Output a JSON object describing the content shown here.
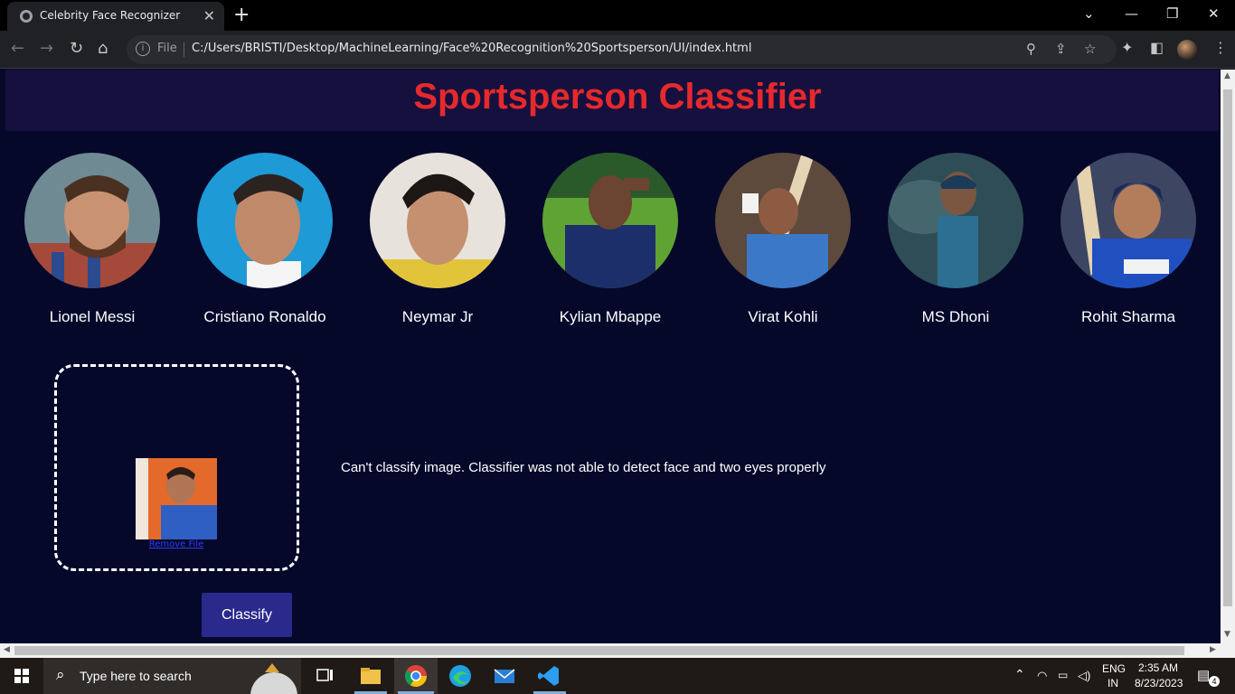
{
  "browser": {
    "tab_title": "Celebrity Face Recognizer",
    "close_tab": "✕",
    "new_tab": "+",
    "file_label": "File",
    "url": "C:/Users/BRISTI/Desktop/MachineLearning/Face%20Recognition%20Sportsperson/UI/index.html"
  },
  "page": {
    "title": "Sportsperson Classifier",
    "players": [
      {
        "name": "Lionel Messi"
      },
      {
        "name": "Cristiano Ronaldo"
      },
      {
        "name": "Neymar Jr"
      },
      {
        "name": "Kylian Mbappe"
      },
      {
        "name": "Virat Kohli"
      },
      {
        "name": "MS Dhoni"
      },
      {
        "name": "Rohit Sharma"
      }
    ],
    "dropzone": {
      "remove_link": "Remove File"
    },
    "result_message": "Can't classify image. Classifier was not able to detect face and two eyes properly",
    "classify_button": "Classify"
  },
  "taskbar": {
    "search_placeholder": "Type here to search",
    "lang_top": "ENG",
    "lang_bottom": "IN",
    "time": "2:35 AM",
    "date": "8/23/2023",
    "notification_count": "4"
  },
  "colors": {
    "title_red": "#e5292c",
    "page_bg": "#06082a",
    "banner_bg": "#16103e",
    "button_bg": "#292a8c"
  }
}
